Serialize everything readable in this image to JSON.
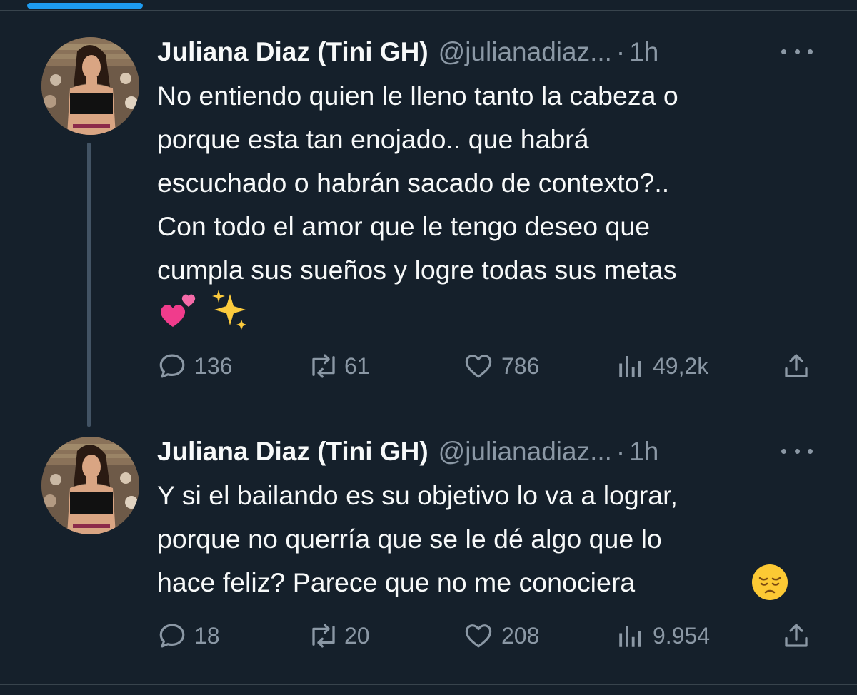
{
  "colors": {
    "background": "#15202b",
    "text": "#f7f9f9",
    "secondary_text": "#8b98a5",
    "accent": "#1d9bf0",
    "divider": "#38444d"
  },
  "tweets": [
    {
      "author": {
        "display_name": "Juliana Diaz (Tini GH)",
        "handle": "@julianadiaz...",
        "avatar": "profile-photo"
      },
      "separator": "·",
      "time": "1h",
      "text": "No entiendo quien le lleno tanto la cabeza o\nporque esta tan enojado.. que habrá\nescuchado o habrán sacado de contexto?..\nCon todo el amor que le tengo deseo que\ncumpla sus sueños y logre todas sus metas",
      "trailing_emoji": [
        "two-hearts-emoji",
        "sparkles-emoji"
      ],
      "stats": {
        "replies": "136",
        "retweets": "61",
        "likes": "786",
        "views": "49,2k"
      }
    },
    {
      "author": {
        "display_name": "Juliana Diaz (Tini GH)",
        "handle": "@julianadiaz...",
        "avatar": "profile-photo"
      },
      "separator": "·",
      "time": "1h",
      "text": "Y si el bailando es su objetivo lo va a lograr,\nporque no querría que se le dé algo que lo\nhace feliz? Parece que no me conociera",
      "trailing_emoji": [
        "pensive-face-emoji"
      ],
      "stats": {
        "replies": "18",
        "retweets": "20",
        "likes": "208",
        "views": "9.954"
      }
    }
  ],
  "icons": {
    "reply": "speech-bubble-icon",
    "retweet": "retweet-icon",
    "like": "heart-icon",
    "views": "bar-chart-icon",
    "share": "share-icon",
    "more": "more-dots-icon"
  }
}
